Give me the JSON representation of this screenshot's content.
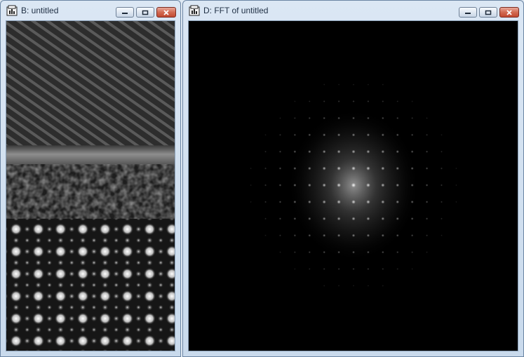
{
  "windows": [
    {
      "title": "B: untitled",
      "image": "hrtem-image"
    },
    {
      "title": "D: FFT of untitled",
      "image": "fft-image"
    }
  ],
  "icons": {
    "app": "app-window-icon",
    "minimize": "minimize-icon",
    "maximize": "maximize-icon",
    "close": "close-icon"
  },
  "colors": {
    "frame": "#c9daec",
    "close_button": "#c24a32",
    "image_background": "#000000"
  }
}
